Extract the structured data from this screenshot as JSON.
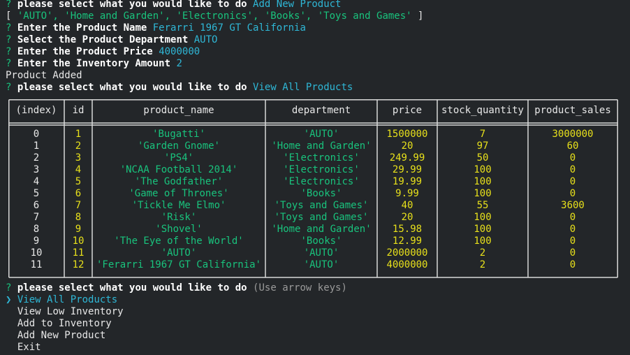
{
  "colors": {
    "background": "#232629",
    "prompt_mark": "#19c37d",
    "answer": "#2fb7d6",
    "string": "#19c37d",
    "number": "#e7e01b",
    "text": "#e8e8e8"
  },
  "lines": {
    "q1_mark": "?",
    "q1_text": "please select what you would like to do",
    "q1_answer": "Add New Product",
    "dept_open": "[ ",
    "dept_list": "'AUTO', 'Home and Garden', 'Electronics', 'Books', 'Toys and Games'",
    "dept_close": " ]",
    "q2_mark": "?",
    "q2_text": "Enter the Product Name",
    "q2_answer": "Ferarri 1967 GT California",
    "q3_mark": "?",
    "q3_text": "Select the Product Department",
    "q3_answer": "AUTO",
    "q4_mark": "?",
    "q4_text": "Enter the Product Price",
    "q4_answer": "4000000",
    "q5_mark": "?",
    "q5_text": "Enter the Inventory Amount",
    "q5_answer": "2",
    "status": "Product Added",
    "q6_mark": "?",
    "q6_text": "please select what you would like to do",
    "q6_answer": "View All Products"
  },
  "table": {
    "headers": [
      "(index)",
      "id",
      "product_name",
      "department",
      "price",
      "stock_quantity",
      "product_sales"
    ],
    "rows": [
      [
        "0",
        "1",
        "'Bugatti'",
        "'AUTO'",
        "1500000",
        "7",
        "3000000"
      ],
      [
        "1",
        "2",
        "'Garden Gnome'",
        "'Home and Garden'",
        "20",
        "97",
        "60"
      ],
      [
        "2",
        "3",
        "'PS4'",
        "'Electronics'",
        "249.99",
        "50",
        "0"
      ],
      [
        "3",
        "4",
        "'NCAA Football 2014'",
        "'Electronics'",
        "29.99",
        "100",
        "0"
      ],
      [
        "4",
        "5",
        "'The Godfather'",
        "'Electronics'",
        "19.99",
        "100",
        "0"
      ],
      [
        "5",
        "6",
        "'Game of Thrones'",
        "'Books'",
        "9.99",
        "100",
        "0"
      ],
      [
        "6",
        "7",
        "'Tickle Me Elmo'",
        "'Toys and Games'",
        "40",
        "55",
        "3600"
      ],
      [
        "7",
        "8",
        "'Risk'",
        "'Toys and Games'",
        "20",
        "100",
        "0"
      ],
      [
        "8",
        "9",
        "'Shovel'",
        "'Home and Garden'",
        "15.98",
        "100",
        "0"
      ],
      [
        "9",
        "10",
        "'The Eye of the World'",
        "'Books'",
        "12.99",
        "100",
        "0"
      ],
      [
        "10",
        "11",
        "'AUTO'",
        "'AUTO'",
        "2000000",
        "2",
        "0"
      ],
      [
        "11",
        "12",
        "'Ferarri 1967 GT California'",
        "'AUTO'",
        "4000000",
        "2",
        "0"
      ]
    ]
  },
  "prompt": {
    "mark": "?",
    "text": "please select what you would like to do",
    "hint": "(Use arrow keys)",
    "pointer": "❯",
    "options": [
      "View All Products",
      "View Low Inventory",
      "Add to Inventory",
      "Add New Product",
      "Exit"
    ],
    "selected_index": 0
  }
}
